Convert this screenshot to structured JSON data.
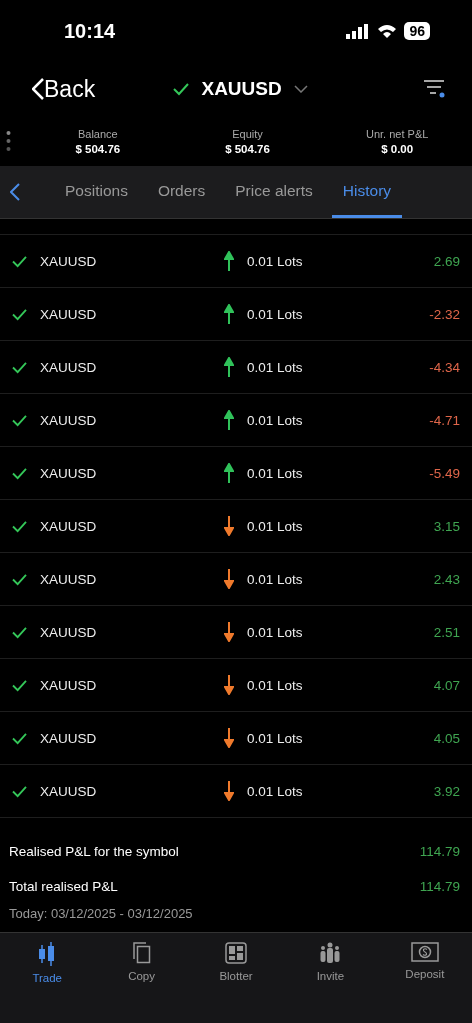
{
  "status_bar": {
    "time": "10:14",
    "battery": "96"
  },
  "header": {
    "back": "Back",
    "symbol": "XAUUSD",
    "symbol_checked": true
  },
  "stats": [
    {
      "label": "Balance",
      "value": "$ 504.76"
    },
    {
      "label": "Equity",
      "value": "$ 504.76"
    },
    {
      "label": "Unr. net P&L",
      "value": "$ 0.00"
    }
  ],
  "tabs": [
    {
      "label": "Positions",
      "selected": false
    },
    {
      "label": "Orders",
      "selected": false
    },
    {
      "label": "Price alerts",
      "selected": false
    },
    {
      "label": "History",
      "selected": true
    }
  ],
  "rows": [
    {
      "symbol": "XAUUSD",
      "kind": "buy",
      "lots": "0.01 Lots",
      "pnl": "2.69",
      "color": "#3fa551"
    },
    {
      "symbol": "XAUUSD",
      "kind": "buy",
      "lots": "0.01 Lots",
      "pnl": "-2.32",
      "color": "#e0664a"
    },
    {
      "symbol": "XAUUSD",
      "kind": "buy",
      "lots": "0.01 Lots",
      "pnl": "-4.34",
      "color": "#e0664a"
    },
    {
      "symbol": "XAUUSD",
      "kind": "buy",
      "lots": "0.01 Lots",
      "pnl": "-4.71",
      "color": "#e0664a"
    },
    {
      "symbol": "XAUUSD",
      "kind": "buy",
      "lots": "0.01 Lots",
      "pnl": "-5.49",
      "color": "#e0664a"
    },
    {
      "symbol": "XAUUSD",
      "kind": "sell",
      "lots": "0.01 Lots",
      "pnl": "3.15",
      "color": "#3fa551"
    },
    {
      "symbol": "XAUUSD",
      "kind": "sell",
      "lots": "0.01 Lots",
      "pnl": "2.43",
      "color": "#3fa551"
    },
    {
      "symbol": "XAUUSD",
      "kind": "sell",
      "lots": "0.01 Lots",
      "pnl": "2.51",
      "color": "#3fa551"
    },
    {
      "symbol": "XAUUSD",
      "kind": "sell",
      "lots": "0.01 Lots",
      "pnl": "4.07",
      "color": "#3fa551"
    },
    {
      "symbol": "XAUUSD",
      "kind": "sell",
      "lots": "0.01 Lots",
      "pnl": "4.05",
      "color": "#3fa551"
    },
    {
      "symbol": "XAUUSD",
      "kind": "sell",
      "lots": "0.01 Lots",
      "pnl": "3.92",
      "color": "#3fa551"
    }
  ],
  "summary": [
    {
      "label": "Realised P&L for the symbol",
      "value": "114.79"
    },
    {
      "label": "Total realised P&L",
      "value": "114.79"
    }
  ],
  "date_range": "Today: 03/12/2025 - 03/12/2025",
  "nav": [
    {
      "label": "Trade",
      "kind": "candles",
      "selected": true
    },
    {
      "label": "Copy",
      "kind": "copy",
      "selected": false
    },
    {
      "label": "Blotter",
      "kind": "grid",
      "selected": false
    },
    {
      "label": "Invite",
      "kind": "people",
      "selected": false
    },
    {
      "label": "Deposit",
      "kind": "money",
      "selected": false
    }
  ]
}
